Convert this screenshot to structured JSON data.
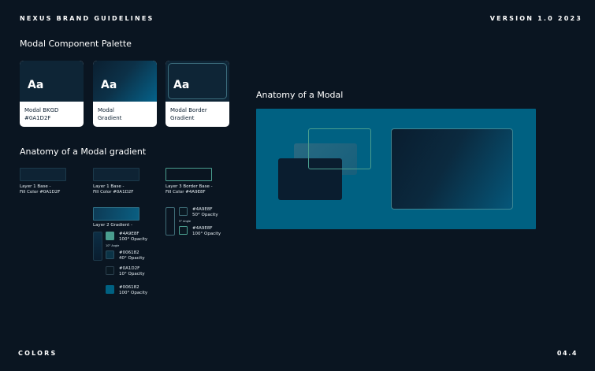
{
  "header": {
    "title": "NEXUS BRAND GUIDELINES",
    "version": "VERSION 1.0 2023"
  },
  "palette": {
    "heading": "Modal Component Palette",
    "cards": [
      {
        "sample": "Aa",
        "label": "Modal BKGD\n#0A1D2F",
        "color": "#0A1D2F"
      },
      {
        "sample": "Aa",
        "label": "Modal\nGradient",
        "color": "#006182"
      },
      {
        "sample": "Aa",
        "label": "Modal Border\nGradient",
        "color": "#4A9E8F"
      }
    ]
  },
  "gradient_anatomy": {
    "heading": "Anatomy of a Modal gradient",
    "layer1a": "Layer 1 Base -\nFill Color #0A1D2F",
    "layer1b": "Layer 1 Base -\nFill Color #0A1D2F",
    "layer3": "Layer 3 Border Base -\nFill Color #4A9E8F",
    "layer2": "Layer 2 Gradient -",
    "layer2_angle": "10° Angle",
    "layer3_angle": "5° Angle",
    "layer2_stops": [
      {
        "text": "#4A9E8F\n100° Opacity",
        "color": "#4A9E8F"
      },
      {
        "text": "#006182\n40° Opacity",
        "color": "#006182"
      },
      {
        "text": "#0A1D2F\n10° Opacity",
        "color": "#0A1D2F"
      },
      {
        "text": "#006182\n100° Opacity",
        "color": "#006182"
      }
    ],
    "layer3_stops": [
      {
        "text": "#4A9E8F\n50° Opacity",
        "color": "#4A9E8F"
      },
      {
        "text": "#4A9E8F\n100° Opacity",
        "color": "#4A9E8F"
      }
    ]
  },
  "modal_anatomy": {
    "heading": "Anatomy of a Modal",
    "panel_color": "#006182"
  },
  "footer": {
    "section": "COLORS",
    "page": "04.4"
  }
}
